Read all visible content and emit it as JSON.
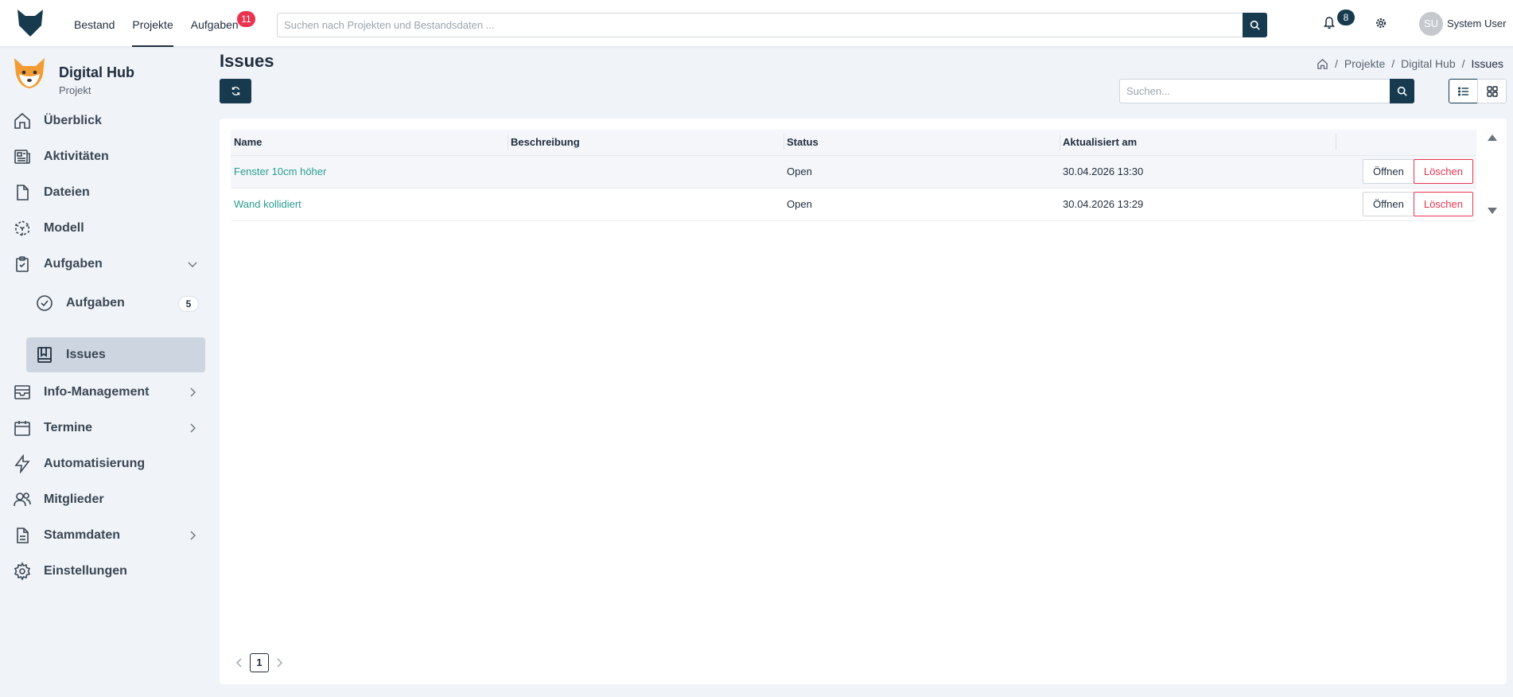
{
  "topnav": {
    "items": [
      {
        "label": "Bestand"
      },
      {
        "label": "Projekte"
      },
      {
        "label": "Aufgaben",
        "badge": "11"
      }
    ],
    "search_placeholder": "Suchen nach Projekten und Bestandsdaten ...",
    "notifications_count": "8",
    "user_initials": "SU",
    "user_name": "System User"
  },
  "sidebar": {
    "project_name": "Digital Hub",
    "project_type": "Projekt",
    "items": [
      {
        "label": "Überblick",
        "icon": "home-icon"
      },
      {
        "label": "Aktivitäten",
        "icon": "newspaper-icon"
      },
      {
        "label": "Dateien",
        "icon": "file-icon"
      },
      {
        "label": "Modell",
        "icon": "cube-icon"
      },
      {
        "label": "Aufgaben",
        "icon": "clipboard-check-icon"
      },
      {
        "label": "Info-Management",
        "icon": "inbox-icon"
      },
      {
        "label": "Termine",
        "icon": "calendar-icon"
      },
      {
        "label": "Automatisierung",
        "icon": "lightning-icon"
      },
      {
        "label": "Mitglieder",
        "icon": "users-icon"
      },
      {
        "label": "Stammdaten",
        "icon": "document-icon"
      },
      {
        "label": "Einstellungen",
        "icon": "gear-icon"
      }
    ],
    "sub_items": [
      {
        "label": "Aufgaben",
        "count": "5",
        "icon": "check-circle-icon"
      },
      {
        "label": "Issues",
        "icon": "book-icon"
      }
    ]
  },
  "main": {
    "title": "Issues",
    "breadcrumb": [
      "Projekte",
      "Digital Hub",
      "Issues"
    ],
    "search_placeholder": "Suchen...",
    "table": {
      "headers": [
        "Name",
        "Beschreibung",
        "Status",
        "Aktualisiert am"
      ],
      "rows": [
        {
          "name": "Fenster 10cm höher",
          "description": "",
          "status": "Open",
          "updated": "30.04.2026 13:30"
        },
        {
          "name": "Wand kollidiert",
          "description": "",
          "status": "Open",
          "updated": "30.04.2026 13:29"
        }
      ],
      "open_label": "Öffnen",
      "delete_label": "Löschen"
    },
    "pagination": {
      "current_page": "1"
    }
  },
  "colors": {
    "primary": "#173a4f",
    "accent_link": "#2a9d8f",
    "danger": "#e8344e",
    "background": "#f0f3f7"
  }
}
